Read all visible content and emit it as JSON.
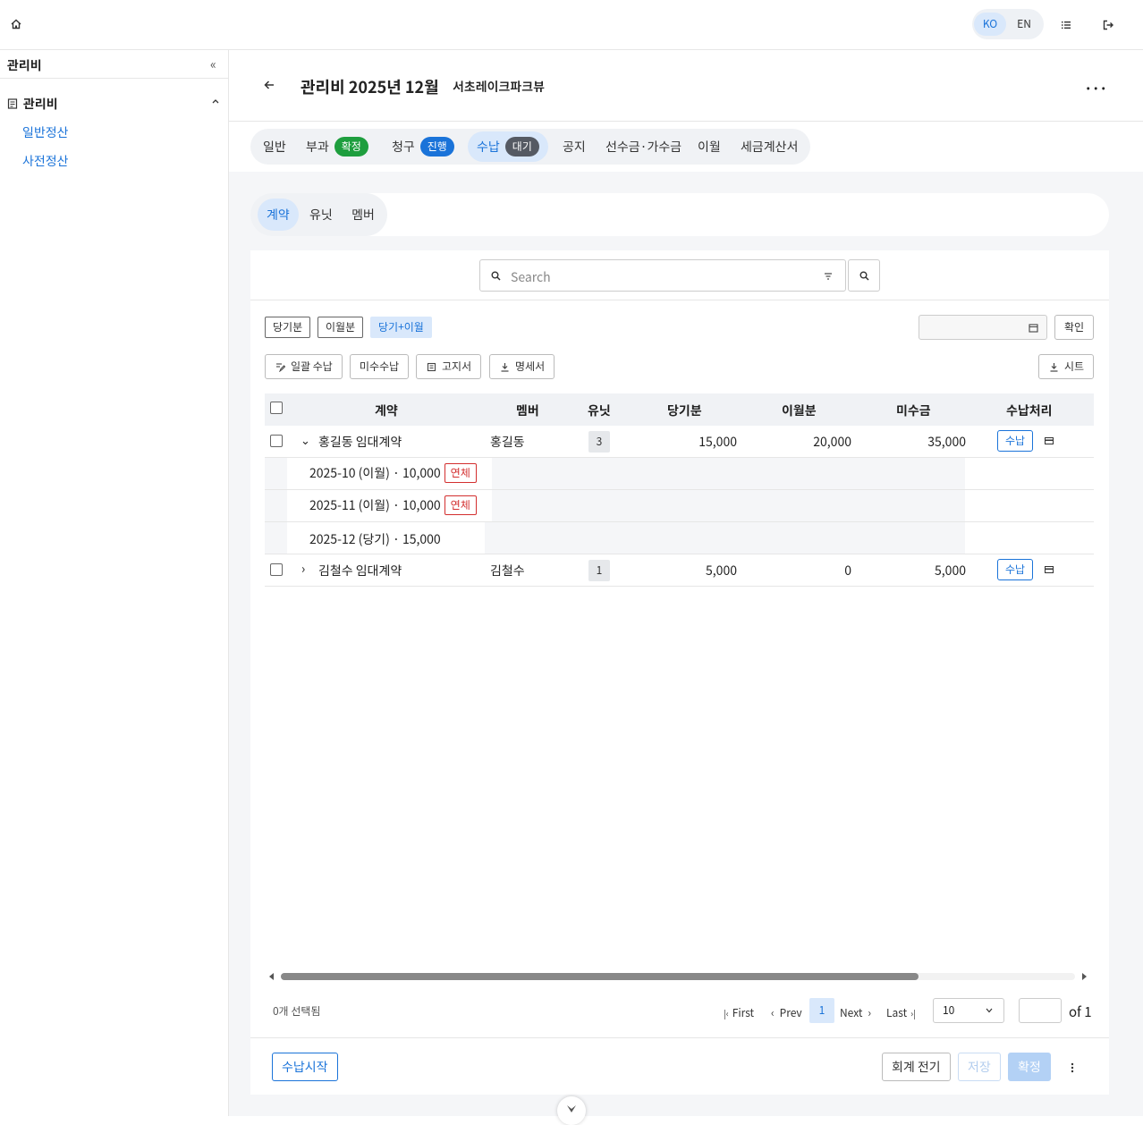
{
  "header": {
    "lang": {
      "ko": "KO",
      "en": "EN"
    }
  },
  "sidebar": {
    "title": "관리비",
    "collapse": "«",
    "group": "관리비",
    "items": [
      "일반정산",
      "사전정산"
    ]
  },
  "page": {
    "title": "관리비 2025년 12월",
    "subtitle": "서초레이크파크뷰",
    "more": "···"
  },
  "tabs": [
    {
      "label": "일반"
    },
    {
      "label": "부과",
      "badge": "확정",
      "badge_color": "#1e9e3e"
    },
    {
      "label": "청구",
      "badge": "진행",
      "badge_color": "#1a73d9"
    },
    {
      "label": "수납",
      "badge": "대기",
      "badge_color": "#555a63"
    },
    {
      "label": "공지"
    },
    {
      "label": "선수금·가수금"
    },
    {
      "label": "이월"
    },
    {
      "label": "세금계산서"
    }
  ],
  "subtabs": [
    "계약",
    "유닛",
    "멤버"
  ],
  "search": {
    "placeholder": "Search"
  },
  "filters": {
    "current": "당기분",
    "carry": "이월분",
    "both": "당기+이월",
    "confirm": "확인"
  },
  "actions": {
    "bulk": "일괄 수납",
    "unpaid": "미수수납",
    "notice": "고지서",
    "statement": "명세서",
    "sheet": "시트"
  },
  "table": {
    "headers": {
      "contract": "계약",
      "member": "멤버",
      "unit": "유닛",
      "current": "당기분",
      "carry": "이월분",
      "unpaid": "미수금",
      "process": "수납처리"
    },
    "rows": [
      {
        "contract": "홍길동 임대계약",
        "member": "홍길동",
        "unit": "3",
        "current": "15,000",
        "carry": "20,000",
        "unpaid": "35,000",
        "action": "수납",
        "expanded": "⌄"
      },
      {
        "contract": "김철수 임대계약",
        "member": "김철수",
        "unit": "1",
        "current": "5,000",
        "carry": "0",
        "unpaid": "5,000",
        "action": "수납",
        "expanded": "›"
      }
    ],
    "details": [
      {
        "text": "2025-10 (이월) · 10,000",
        "tag": "연체"
      },
      {
        "text": "2025-11 (이월) · 10,000",
        "tag": "연체"
      },
      {
        "text": "2025-12 (당기) · 15,000",
        "tag": ""
      }
    ]
  },
  "pagination": {
    "selected": "0개 선택됨",
    "first": "First",
    "prev": "Prev",
    "current": "1",
    "next": "Next",
    "last": "Last",
    "page_size": "10",
    "of": "of 1"
  },
  "footer": {
    "start": "수납시작",
    "post": "회계 전기",
    "save": "저장",
    "confirm": "확정"
  }
}
